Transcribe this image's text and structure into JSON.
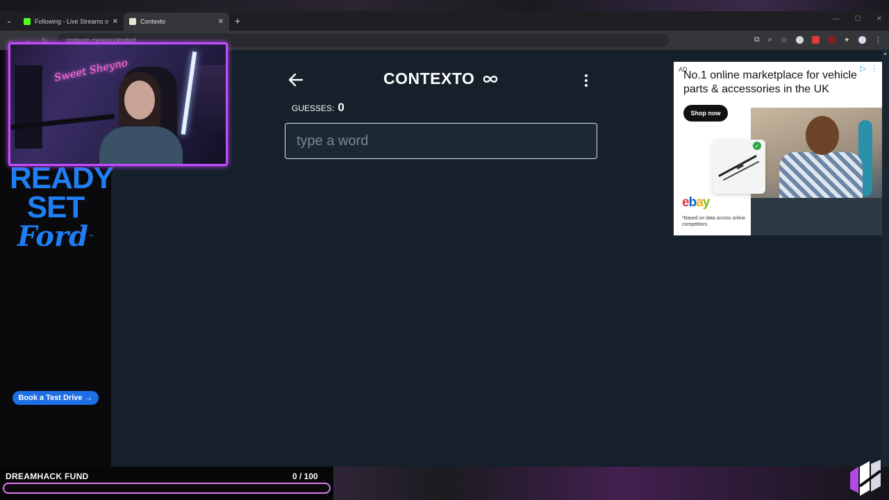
{
  "browser": {
    "tabs": [
      {
        "title": "Following - Live Streams on Kick",
        "active": false
      },
      {
        "title": "Contexto",
        "active": true
      }
    ],
    "url": "contexto.me/en/unlimited"
  },
  "left_ad": {
    "line1": "READY",
    "line2": "SET",
    "line3": "Ford",
    "tm": "™",
    "cta": "Book a Test Drive"
  },
  "app": {
    "logo": "CONTEXTO",
    "guesses_label": "GUESSES:",
    "guesses_value": "0",
    "input_placeholder": "type a word"
  },
  "ebay_ad": {
    "tag": "AD",
    "headline": "No.1 online marketplace for vehicle parts & accessories in the UK",
    "cta": "Shop now",
    "logo": "ebay",
    "disclaimer": "*Based on data across online competitors."
  },
  "overlay": {
    "fund_label": "DREAMHACK FUND",
    "fund_count": "0  / 100",
    "fund_progress": 0.0,
    "neon_sign": "Sweet Sheyno"
  },
  "colors": {
    "page_bg": "#15202b",
    "webcam_border": "#c34dff",
    "ford_blue": "#1f7ef3",
    "fund_bar": "#e07bf0"
  }
}
